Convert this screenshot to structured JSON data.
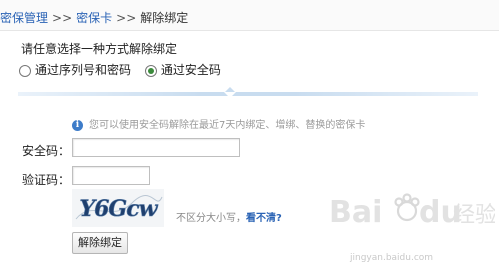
{
  "breadcrumb": {
    "items": [
      "密保管理",
      "密保卡",
      "解除绑定"
    ],
    "separator": ">>"
  },
  "form": {
    "prompt": "请任意选择一种方式解除绑定",
    "options": [
      {
        "label": "通过序列号和密码",
        "selected": false
      },
      {
        "label": "通过安全码",
        "selected": true
      }
    ],
    "info": "您可以使用安全码解除在最近7天内绑定、增绑、替换的密保卡",
    "security_code_label": "安全码：",
    "security_code_value": "",
    "verify_label": "验证码：",
    "verify_value": "",
    "captcha_text": "Y6Gcw",
    "case_hint": "不区分大小写，",
    "cant_see": "看不清?",
    "submit_label": "解除绑定"
  },
  "watermark": {
    "brand": "Bai du 经验",
    "url": "jingyan.baidu.com"
  },
  "colors": {
    "link": "#2a63b5",
    "info_icon": "#3d7cc9",
    "divider": "#c8dcef"
  }
}
